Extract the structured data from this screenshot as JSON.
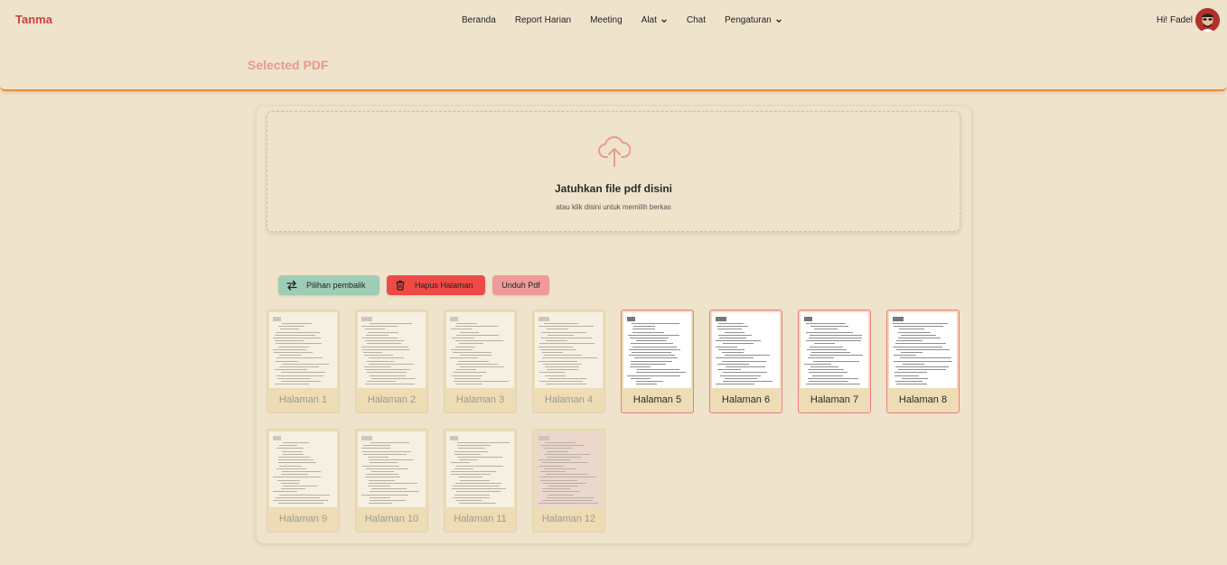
{
  "navbar": {
    "brand": "Tanma",
    "links": [
      {
        "label": "Beranda",
        "dropdown": false
      },
      {
        "label": "Report Harian",
        "dropdown": false
      },
      {
        "label": "Meeting",
        "dropdown": false
      },
      {
        "label": "Alat",
        "dropdown": true
      },
      {
        "label": "Chat",
        "dropdown": false
      },
      {
        "label": "Pengaturan",
        "dropdown": true
      }
    ],
    "greeting": "Hi! Fadel"
  },
  "header": {
    "title": "Selected PDF"
  },
  "dropzone": {
    "title": "Jatuhkan file pdf disini",
    "subtitle": "atau klik disini untuk memilih berkas"
  },
  "actions": {
    "swap_label": "Pilihan pembalik",
    "delete_label": "Hapus Halaman",
    "download_label": "Unduh Pdf"
  },
  "pages": [
    {
      "label": "Halaman 1",
      "selected": false
    },
    {
      "label": "Halaman 2",
      "selected": false
    },
    {
      "label": "Halaman 3",
      "selected": false
    },
    {
      "label": "Halaman 4",
      "selected": false
    },
    {
      "label": "Halaman 5",
      "selected": true
    },
    {
      "label": "Halaman 6",
      "selected": true
    },
    {
      "label": "Halaman 7",
      "selected": true
    },
    {
      "label": "Halaman 8",
      "selected": true
    },
    {
      "label": "Halaman 9",
      "selected": false
    },
    {
      "label": "Halaman 10",
      "selected": false
    },
    {
      "label": "Halaman 11",
      "selected": false
    },
    {
      "label": "Halaman 12",
      "selected": false
    }
  ],
  "colors": {
    "background": "#efe3cb",
    "brand": "#c8413c",
    "accent_line": "#e88a3e",
    "title": "#e89a8e",
    "swap_button": "#9ecdb5",
    "delete_button": "#ee4a46",
    "download_button": "#ef9a99",
    "selected_border": "#ef7b86"
  }
}
